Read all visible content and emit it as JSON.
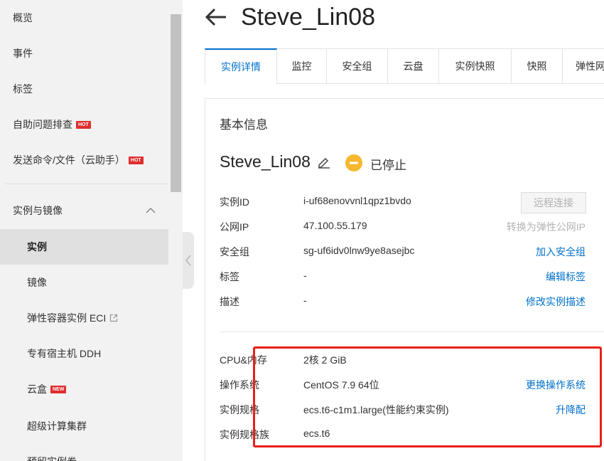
{
  "sidebar": {
    "items": [
      {
        "label": "概览"
      },
      {
        "label": "事件"
      },
      {
        "label": "标签"
      },
      {
        "label": "自助问题排查",
        "badge": "HOT"
      },
      {
        "label": "发送命令/文件（云助手）",
        "badge": "HOT"
      }
    ],
    "group": {
      "label": "实例与镜像",
      "expanded": true,
      "chevron_icon": "chevron-up-icon"
    },
    "group_items": [
      {
        "label": "实例",
        "active": true
      },
      {
        "label": "镜像"
      },
      {
        "label": "弹性容器实例 ECI",
        "icon": "external-link-icon"
      },
      {
        "label": "专有宿主机 DDH"
      },
      {
        "label": "云盒",
        "badge": "NEW"
      },
      {
        "label": "超级计算集群"
      },
      {
        "label": "预留实例券"
      }
    ],
    "badge_colors": {
      "HOT": "#e02d2d",
      "NEW": "#e02d2d"
    },
    "collapse_icon": "chevron-left-icon"
  },
  "header": {
    "back_icon": "arrow-left-icon",
    "title": "Steve_Lin08"
  },
  "tabs": [
    {
      "label": "实例详情",
      "active": true
    },
    {
      "label": "监控"
    },
    {
      "label": "安全组"
    },
    {
      "label": "云盘"
    },
    {
      "label": "实例快照"
    },
    {
      "label": "快照"
    },
    {
      "label": "弹性网"
    }
  ],
  "basic_info": {
    "section_title": "基本信息",
    "instance_name": "Steve_Lin08",
    "edit_icon": "pencil-icon",
    "status": {
      "text": "已停止",
      "icon": "stopped-icon",
      "color": "#f5b82e"
    },
    "rows": [
      {
        "label": "实例ID",
        "value": "i-uf68enovvnl1qpz1bvdo",
        "action": "远程连接",
        "action_type": "disabled-button"
      },
      {
        "label": "公网IP",
        "value": "47.100.55.179",
        "action": "转换为弹性公网IP",
        "action_type": "muted-link"
      },
      {
        "label": "安全组",
        "value": "sg-uf6idv0lnw9ye8asejbc",
        "action": "加入安全组",
        "action_type": "link"
      },
      {
        "label": "标签",
        "value": "-",
        "action": "编辑标签",
        "action_type": "link"
      },
      {
        "label": "描述",
        "value": "-",
        "action": "修改实例描述",
        "action_type": "link"
      }
    ],
    "spec_rows": [
      {
        "label": "CPU&内存",
        "value": "2核 2 GiB",
        "action": ""
      },
      {
        "label": "操作系统",
        "value": "CentOS 7.9 64位",
        "action": "更换操作系统"
      },
      {
        "label": "实例规格",
        "value": "ecs.t6-c1m1.large(性能约束实例)",
        "action": "升降配"
      },
      {
        "label": "实例规格族",
        "value": "ecs.t6",
        "action": ""
      }
    ]
  },
  "colors": {
    "accent": "#0070cc",
    "highlight": "#e8201a"
  }
}
